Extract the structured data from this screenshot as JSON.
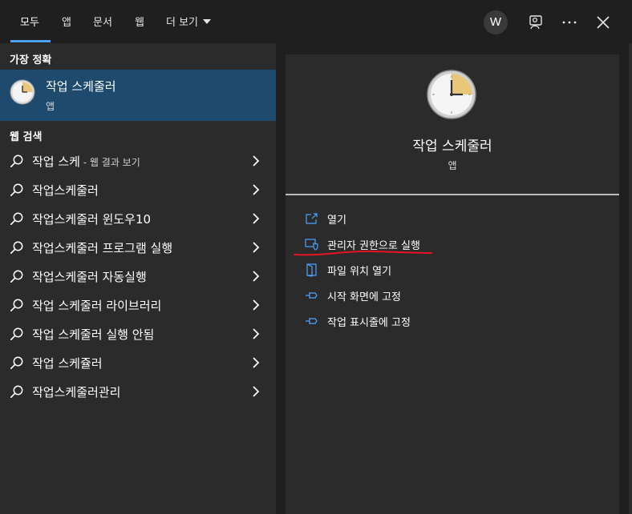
{
  "tabs": [
    {
      "label": "모두"
    },
    {
      "label": "앱"
    },
    {
      "label": "문서"
    },
    {
      "label": "웹"
    },
    {
      "label": "더 보기"
    }
  ],
  "user": {
    "initial": "W"
  },
  "icons": {
    "feedback": "feedback-person-icon",
    "more": "more-dots-icon",
    "close": "close-icon",
    "search": "magnifier-icon",
    "chevron": "chevron-right-icon",
    "app": "clock-icon"
  },
  "colors": {
    "accent": "#4da3ff",
    "selection": "#1e4a6e",
    "annotation": "#e81224"
  },
  "left": {
    "best_match_header": "가장 정확",
    "best_match": {
      "title": "작업 스케줄러",
      "subtitle": "앱"
    },
    "web_search_header": "웹 검색",
    "results": [
      {
        "label": "작업 스케",
        "hint": " - 웹 결과 보기"
      },
      {
        "label": "작업스케줄러",
        "hint": ""
      },
      {
        "label": "작업스케줄러 윈도우10",
        "hint": ""
      },
      {
        "label": "작업스케줄러 프로그램 실행",
        "hint": ""
      },
      {
        "label": "작업스케줄러 자동실행",
        "hint": ""
      },
      {
        "label": "작업 스케줄러 라이브러리",
        "hint": ""
      },
      {
        "label": "작업 스케줄러 실행 안됨",
        "hint": ""
      },
      {
        "label": "작업 스케쥴러",
        "hint": ""
      },
      {
        "label": "작업스케줄러관리",
        "hint": ""
      }
    ]
  },
  "right": {
    "app_name": "작업 스케줄러",
    "app_type": "앱",
    "actions": [
      {
        "label": "열기",
        "icon": "open-icon"
      },
      {
        "label": "관리자 권한으로 실행",
        "icon": "run-as-admin-shield-icon"
      },
      {
        "label": "파일 위치 열기",
        "icon": "file-location-icon"
      },
      {
        "label": "시작 화면에 고정",
        "icon": "pin-icon"
      },
      {
        "label": "작업 표시줄에 고정",
        "icon": "pin-icon"
      }
    ]
  }
}
